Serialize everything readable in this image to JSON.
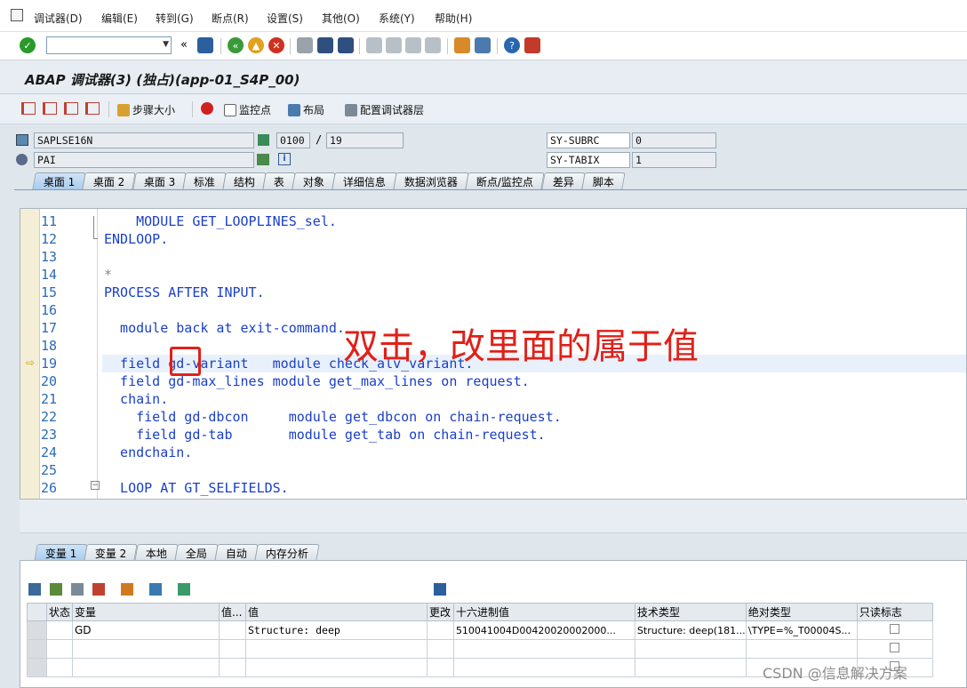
{
  "menu": [
    "调试器(D)",
    "编辑(E)",
    "转到(G)",
    "断点(R)",
    "设置(S)",
    "其他(O)",
    "系统(Y)",
    "帮助(H)"
  ],
  "title": "ABAP 调试器(3)  (独占)(app-01_S4P_00)",
  "toolbar2": {
    "step_size": "步骤大小",
    "watchpoint": "监控点",
    "layout": "布局",
    "config": "配置调试器层"
  },
  "fields": {
    "program": "SAPLSE16N",
    "screen": "0100",
    "slash": "/",
    "line": "19",
    "event": "PAI",
    "subrc_label": "SY-SUBRC",
    "subrc_value": "0",
    "tabix_label": "SY-TABIX",
    "tabix_value": "1"
  },
  "tabs": [
    "桌面 1",
    "桌面 2",
    "桌面 3",
    "标准",
    "结构",
    "表",
    "对象",
    "详细信息",
    "数据浏览器",
    "断点/监控点",
    "差异",
    "脚本"
  ],
  "code_lines": [
    {
      "no": "11",
      "text": "    MODULE GET_LOOPLINES_sel."
    },
    {
      "no": "12",
      "text": "ENDLOOP."
    },
    {
      "no": "13",
      "text": ""
    },
    {
      "no": "14",
      "text": "*"
    },
    {
      "no": "15",
      "text": "PROCESS AFTER INPUT."
    },
    {
      "no": "16",
      "text": ""
    },
    {
      "no": "17",
      "text": "  module back at exit-command."
    },
    {
      "no": "18",
      "text": ""
    },
    {
      "no": "19",
      "text": "  field gd-variant   module check_alv_variant."
    },
    {
      "no": "20",
      "text": "  field gd-max_lines module get_max_lines on request."
    },
    {
      "no": "21",
      "text": "  chain."
    },
    {
      "no": "22",
      "text": "    field gd-dbcon     module get_dbcon on chain-request."
    },
    {
      "no": "23",
      "text": "    field gd-tab       module get_tab on chain-request."
    },
    {
      "no": "24",
      "text": "  endchain."
    },
    {
      "no": "25",
      "text": ""
    },
    {
      "no": "26",
      "text": "  LOOP AT GT_SELFIELDS."
    }
  ],
  "annotation": "双击，改里面的属于值",
  "var_tabs": [
    "变量 1",
    "变量 2",
    "本地",
    "全局",
    "自动",
    "内存分析"
  ],
  "grid": {
    "headers": [
      "状态",
      "变量",
      "值...",
      "值",
      "更改",
      "十六进制值",
      "技术类型",
      "绝对类型",
      "只读标志"
    ],
    "rows": [
      {
        "status": "",
        "variable": "GD",
        "val_short": "",
        "value": "Structure: deep",
        "change": "",
        "hex": "510041004D00420020002000...",
        "tech_type": "Structure: deep(181...",
        "abs_type": "\\TYPE=%_T00004S...",
        "readonly": ""
      }
    ]
  },
  "watermark": "CSDN @信息解决方案"
}
